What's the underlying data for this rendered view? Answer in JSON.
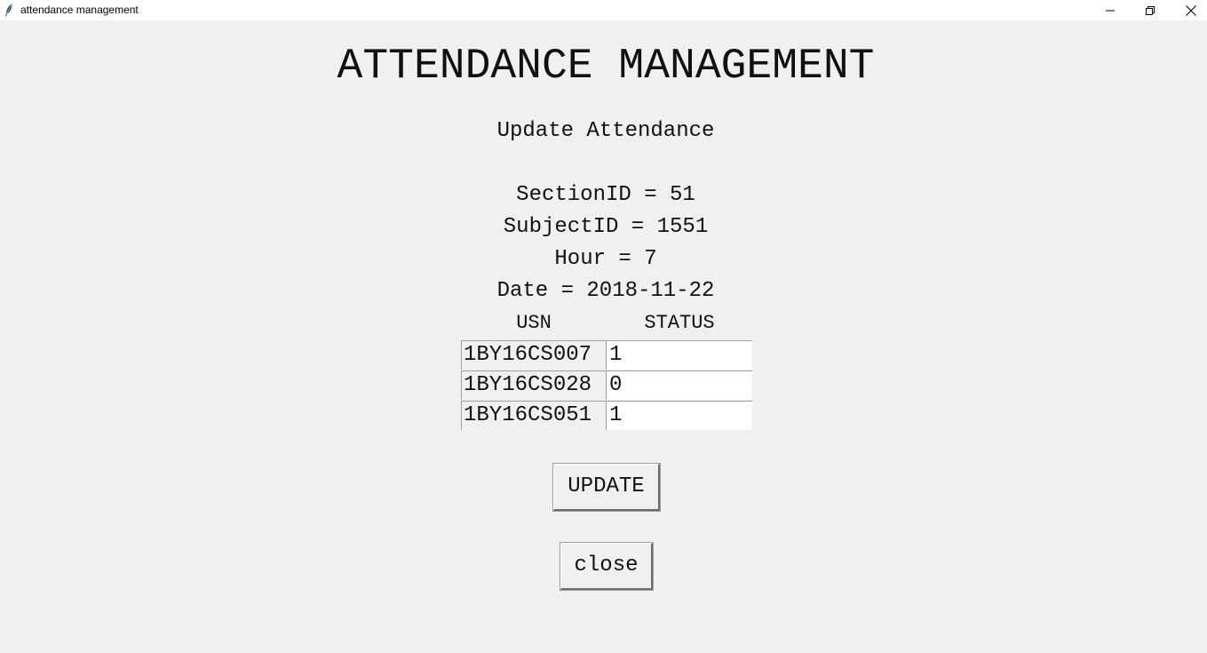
{
  "window": {
    "title": "attendance management",
    "controls": {
      "minimize_icon": "minimize-icon",
      "maximize_icon": "restore-icon",
      "close_icon": "close-icon"
    }
  },
  "main": {
    "heading": "ATTENDANCE MANAGEMENT",
    "subheading": "Update Attendance",
    "info": {
      "section": "SectionID = 51",
      "subject": "SubjectID = 1551",
      "hour": "Hour = 7",
      "date": "Date = 2018-11-22"
    },
    "table": {
      "headers": {
        "usn": "USN",
        "status": "STATUS"
      },
      "rows": [
        {
          "usn": "1BY16CS007",
          "status": "1"
        },
        {
          "usn": "1BY16CS028",
          "status": "0"
        },
        {
          "usn": "1BY16CS051",
          "status": "1"
        }
      ]
    },
    "buttons": {
      "update": "UPDATE",
      "close": "close"
    }
  }
}
